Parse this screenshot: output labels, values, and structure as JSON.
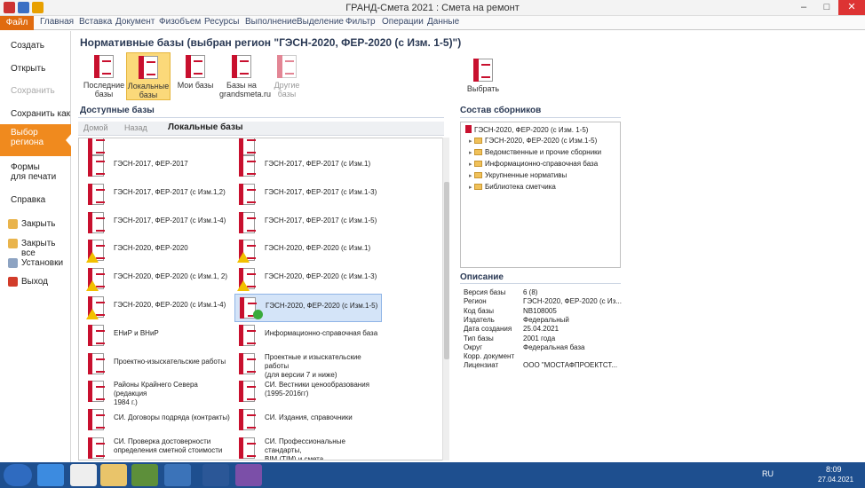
{
  "window": {
    "title": "ГРАНД-Смета 2021 : Смета на ремонт"
  },
  "ribbon": {
    "tabs": [
      "Файл",
      "Главная",
      "Вставка",
      "Документ",
      "Физобъем",
      "Ресурсы",
      "Выполнение",
      "Выделение",
      "Фильтр",
      "Операции",
      "Данные"
    ]
  },
  "sidebar": {
    "create": "Создать",
    "open": "Открыть",
    "save": "Сохранить",
    "save_as": "Сохранить как",
    "region_l1": "Выбор",
    "region_l2": "региона",
    "forms_l1": "Формы",
    "forms_l2": "для печати",
    "help": "Справка",
    "close": "Закрыть",
    "close_all": "Закрыть все",
    "settings": "Установки",
    "exit": "Выход"
  },
  "main": {
    "title": "Нормативные базы (выбран регион \"ГЭСН-2020, ФЕР-2020 (с Изм. 1-5)\")",
    "toolbar": [
      {
        "l1": "Последние",
        "l2": "базы"
      },
      {
        "l1": "Локальные",
        "l2": "базы"
      },
      {
        "l1": "Мои базы",
        "l2": ""
      },
      {
        "l1": "Базы на",
        "l2": "grandsmeta.ru"
      },
      {
        "l1": "Другие",
        "l2": "базы"
      }
    ],
    "select_label": "Выбрать",
    "available_title": "Доступные базы",
    "nav": {
      "home": "Домой",
      "back": "Назад",
      "current": "Локальные базы"
    },
    "items": [
      {
        "l1": "ГЭСН-2017, ФЕР-2017",
        "l2": ""
      },
      {
        "l1": "ГЭСН-2017, ФЕР-2017 (с Изм.1)",
        "l2": ""
      },
      {
        "l1": "ГЭСН-2017, ФЕР-2017 (с Изм.1,2)",
        "l2": ""
      },
      {
        "l1": "ГЭСН-2017, ФЕР-2017 (с Изм.1-3)",
        "l2": ""
      },
      {
        "l1": "ГЭСН-2017, ФЕР-2017 (с Изм.1-4)",
        "l2": ""
      },
      {
        "l1": "ГЭСН-2017, ФЕР-2017 (с Изм.1-5)",
        "l2": ""
      },
      {
        "l1": "ГЭСН-2020, ФЕР-2020",
        "l2": ""
      },
      {
        "l1": "ГЭСН-2020, ФЕР-2020 (с Изм.1)",
        "l2": ""
      },
      {
        "l1": "ГЭСН-2020, ФЕР-2020 (с Изм.1, 2)",
        "l2": ""
      },
      {
        "l1": "ГЭСН-2020, ФЕР-2020 (с Изм.1-3)",
        "l2": ""
      },
      {
        "l1": "ГЭСН-2020, ФЕР-2020 (с Изм.1-4)",
        "l2": ""
      },
      {
        "l1": "ГЭСН-2020, ФЕР-2020 (с Изм.1-5)",
        "l2": ""
      },
      {
        "l1": "ЕНиР и ВНиР",
        "l2": ""
      },
      {
        "l1": "Информационно-справочная база",
        "l2": ""
      },
      {
        "l1": "Проектно-изыскательские работы",
        "l2": ""
      },
      {
        "l1": "Проектные и изыскательские работы",
        "l2": "(для версии 7 и ниже)"
      },
      {
        "l1": "Районы Крайнего Севера (редакция",
        "l2": "1984 г.)"
      },
      {
        "l1": "СИ. Вестники ценообразования",
        "l2": "(1995-2016гг)"
      },
      {
        "l1": "СИ. Договоры подряда (контракты)",
        "l2": ""
      },
      {
        "l1": "СИ. Издания, справочники",
        "l2": ""
      },
      {
        "l1": "СИ. Проверка достоверности",
        "l2": "определения сметной стоимости"
      },
      {
        "l1": "СИ. Профессиональные стандарты,",
        "l2": "BIM (TIM) и смета"
      }
    ],
    "composition_title": "Состав сборников",
    "tree": [
      {
        "label": "ГЭСН-2020, ФЕР-2020 (с Изм. 1-5)",
        "type": "book",
        "level": 0
      },
      {
        "label": "ГЭСН-2020, ФЕР-2020 (с Изм.1-5)",
        "type": "folder",
        "level": 1
      },
      {
        "label": "Ведомственные и прочие сборники",
        "type": "folder",
        "level": 1
      },
      {
        "label": "Информационно-справочная база",
        "type": "folder",
        "level": 1
      },
      {
        "label": "Укрупненные нормативы",
        "type": "folder",
        "level": 1
      },
      {
        "label": "Библиотека сметчика",
        "type": "folder",
        "level": 1
      }
    ],
    "description_title": "Описание",
    "description": [
      {
        "k": "Версия базы",
        "v": "6 (8)"
      },
      {
        "k": "Регион",
        "v": "ГЭСН-2020, ФЕР-2020 (с Из..."
      },
      {
        "k": "Код базы",
        "v": "NB108005"
      },
      {
        "k": "Издатель",
        "v": "Федеральный"
      },
      {
        "k": "Дата создания",
        "v": "25.04.2021"
      },
      {
        "k": "Тип базы",
        "v": "2001 года"
      },
      {
        "k": "Округ",
        "v": "Федеральная база"
      },
      {
        "k": "Корр. документ",
        "v": ""
      },
      {
        "k": "Лицензиат",
        "v": "ООО \"МОСТАФПРОЕКТСТ..."
      }
    ]
  },
  "taskbar": {
    "lang": "RU",
    "time": "8:09",
    "date": "27.04.2021"
  }
}
